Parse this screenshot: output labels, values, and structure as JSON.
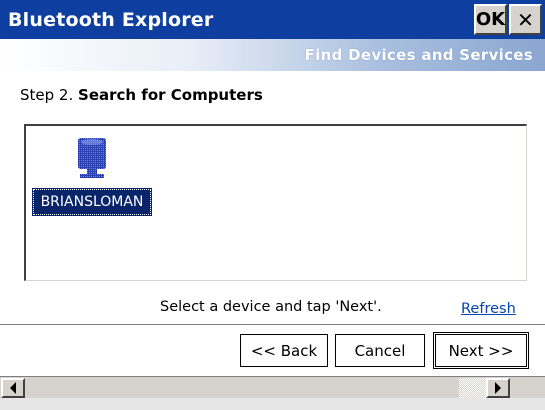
{
  "window": {
    "title": "Bluetooth Explorer",
    "ok_label": "OK",
    "close_label": "✕"
  },
  "header": {
    "subtitle": "Find Devices and Services"
  },
  "step": {
    "prefix": "Step 2.",
    "title": "Search for Computers"
  },
  "devices": [
    {
      "name": "BRIANSLOMAN",
      "icon": "computer-device-icon",
      "selected": true
    }
  ],
  "hint": "Select a device and tap 'Next'.",
  "refresh_label": "Refresh",
  "buttons": {
    "back": "<< Back",
    "cancel": "Cancel",
    "next": "Next >>"
  },
  "colors": {
    "titlebar": "#0e3fa0",
    "selection": "#0a246a",
    "link": "#0645ad"
  }
}
